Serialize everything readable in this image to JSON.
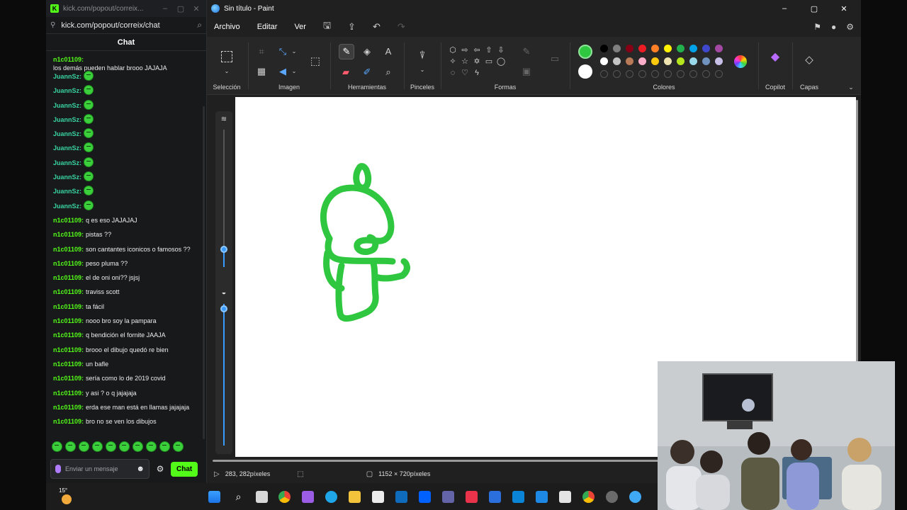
{
  "kick_window": {
    "tab_title": "kick.com/popout/correix...",
    "url": "kick.com/popout/correix/chat",
    "chat_title": "Chat",
    "messages": [
      {
        "user": "n1c01109:",
        "text": "los demás pueden hablar brooo JAJAJA",
        "emote": false
      },
      {
        "user": "JuannSz:",
        "text": "",
        "emote": true
      },
      {
        "user": "JuannSz:",
        "text": "",
        "emote": true
      },
      {
        "user": "JuannSz:",
        "text": "",
        "emote": true
      },
      {
        "user": "JuannSz:",
        "text": "",
        "emote": true
      },
      {
        "user": "JuannSz:",
        "text": "",
        "emote": true
      },
      {
        "user": "JuannSz:",
        "text": "",
        "emote": true
      },
      {
        "user": "JuannSz:",
        "text": "",
        "emote": true
      },
      {
        "user": "JuannSz:",
        "text": "",
        "emote": true
      },
      {
        "user": "JuannSz:",
        "text": "",
        "emote": true
      },
      {
        "user": "JuannSz:",
        "text": "",
        "emote": true
      },
      {
        "user": "n1c01109:",
        "text": "q es eso JAJAJAJ",
        "emote": false
      },
      {
        "user": "n1c01109:",
        "text": "pistas ??",
        "emote": false
      },
      {
        "user": "n1c01109:",
        "text": "son cantantes iconicos o famosos ??",
        "emote": false
      },
      {
        "user": "n1c01109:",
        "text": "peso pluma ??",
        "emote": false
      },
      {
        "user": "n1c01109:",
        "text": "el de oni oni?? jsjsj",
        "emote": false
      },
      {
        "user": "n1c01109:",
        "text": "traviss scott",
        "emote": false
      },
      {
        "user": "n1c01109:",
        "text": "ta fácil",
        "emote": false
      },
      {
        "user": "n1c01109:",
        "text": "nooo bro soy la pampara",
        "emote": false
      },
      {
        "user": "n1c01109:",
        "text": "q bendición el fornite JAAJA",
        "emote": false
      },
      {
        "user": "n1c01109:",
        "text": "brooo el dibujo quedó re bien",
        "emote": false
      },
      {
        "user": "n1c01109:",
        "text": "un bafle",
        "emote": false
      },
      {
        "user": "n1c01109:",
        "text": "sería como lo de 2019 covid",
        "emote": false
      },
      {
        "user": "n1c01109:",
        "text": "y asi ? o q jajajaja",
        "emote": false
      },
      {
        "user": "n1c01109:",
        "text": "erda ese man está en llamas jajajaja",
        "emote": false
      },
      {
        "user": "n1c01109:",
        "text": "bro no se ven los dibujos",
        "emote": false
      }
    ],
    "input_placeholder": "Enviar un mensaje",
    "send_label": "Chat",
    "colors": {
      "kick_green": "#53fc18",
      "user_color": "#53fc18"
    }
  },
  "paint": {
    "title": "Sin título - Paint",
    "menu": {
      "file": "Archivo",
      "edit": "Editar",
      "view": "Ver"
    },
    "groups": {
      "selection": "Selección",
      "image": "Imagen",
      "tools": "Herramientas",
      "brushes": "Pinceles",
      "shapes": "Formas",
      "colors": "Colores",
      "copilot": "Copilot",
      "layers": "Capas"
    },
    "active_tool": "pencil-icon",
    "primary_color": "#2fc73f",
    "secondary_color": "#ffffff",
    "palette": [
      "#000000",
      "#7f7f7f",
      "#880015",
      "#ed1c24",
      "#ff7f27",
      "#fff200",
      "#22b14c",
      "#00a2e8",
      "#3f48cc",
      "#a349a4",
      "#ffffff",
      "#c3c3c3",
      "#b97a57",
      "#ffaec9",
      "#ffc90e",
      "#efe4b0",
      "#b5e61d",
      "#99d9ea",
      "#7092be",
      "#c8bfe7"
    ],
    "status": {
      "cursor": "283, 282píxeles",
      "size": "1152 × 720píxeles"
    }
  },
  "taskbar": {
    "temperature": "15°"
  }
}
